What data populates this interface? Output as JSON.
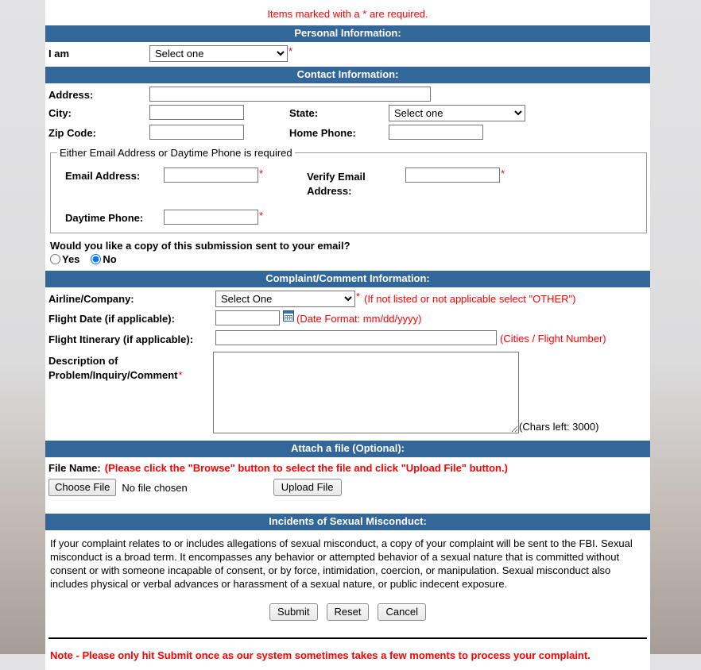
{
  "theme": {
    "section_bar_bg": "#336699",
    "required_red": "#ff0000",
    "page_bg": "#ffffff"
  },
  "top": {
    "required_note": "Items marked with a * are required."
  },
  "sections": {
    "personal": "Personal Information:",
    "contact": "Contact Information:",
    "complaint": "Complaint/Comment Information:",
    "attach": "Attach a file (Optional):",
    "misconduct": "Incidents of Sexual Misconduct:"
  },
  "personal": {
    "i_am_label": "I am",
    "i_am_value": "Select one",
    "i_am_star": "*"
  },
  "contact": {
    "address_label": "Address:",
    "address_value": "",
    "city_label": "City:",
    "city_value": "",
    "state_label": "State:",
    "state_value": "Select one",
    "zip_label": "Zip Code:",
    "zip_value": "",
    "home_phone_label": "Home Phone:",
    "home_phone_value": "",
    "fieldset_legend": "Either Email Address or Daytime Phone is required",
    "email_label": "Email Address:",
    "email_value": "",
    "email_star": "*",
    "verify_email_label": "Verify Email Address:",
    "verify_email_value": "",
    "verify_email_star": "*",
    "daytime_phone_label": "Daytime Phone:",
    "daytime_phone_value": "",
    "daytime_phone_star": "*",
    "copy_question": "Would you like a copy of this submission sent to your email?",
    "radio_yes": "Yes",
    "radio_no": "No",
    "radio_selected": "No"
  },
  "complaint": {
    "airline_label": "Airline/Company:",
    "airline_value": "Select One",
    "airline_star": "*",
    "airline_hint": "(If not listed or not applicable select \"OTHER\")",
    "flight_date_label": "Flight Date (if applicable):",
    "flight_date_value": "",
    "flight_date_hint": "(Date Format: mm/dd/yyyy)",
    "itinerary_label": "Flight Itinerary (if applicable):",
    "itinerary_value": "",
    "itinerary_hint": "(Cities / Flight Number)",
    "description_label": "Description of Problem/Inquiry/Comment",
    "description_star": "*",
    "description_value": "",
    "chars_left": "(Chars left: 3000)"
  },
  "attach": {
    "file_name_label": "File Name:",
    "file_name_hint": "(Please click the \"Browse\" button to select the file and click \"Upload File\" button.)",
    "choose_file_label": "Choose File",
    "file_status": "No file chosen",
    "upload_button_label": "Upload File"
  },
  "misconduct": {
    "body": "If your complaint relates to or includes allegations of sexual misconduct, a copy of your complaint will be sent to the FBI. Sexual misconduct is a broad term. It encompasses any behavior or attempted behavior of a sexual nature that is committed without consent or with someone incapable of consent, or by force, intimidation, coercion, or manipulation. Sexual misconduct also includes physical or verbal advances or harassment of a sexual nature, or public indecent exposure."
  },
  "actions": {
    "submit_label": "Submit",
    "reset_label": "Reset",
    "cancel_label": "Cancel"
  },
  "footer": {
    "note": "Note - Please only hit Submit once as our system sometimes takes a few moments to process your complaint."
  }
}
